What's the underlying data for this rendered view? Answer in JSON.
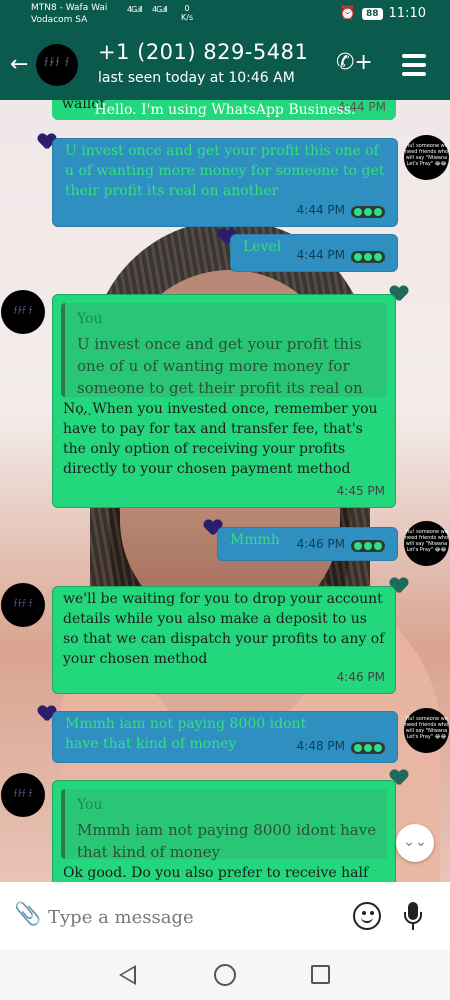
{
  "status_bar": {
    "carrier_line1": "MTN8 - Wafa Wai",
    "carrier_line2": "Vodacom SA",
    "network_a": "4G",
    "network_b": "4G",
    "speed_value": "0",
    "speed_unit": "K/s",
    "battery": "88",
    "time": "11:10"
  },
  "header": {
    "contact_name": "+1 (201) 829-5481",
    "last_seen": "last seen today at 10:46 AM",
    "avatar_text": "⨍⨑⨍ ⨍"
  },
  "chat": {
    "business_status": "Hello. I'm using WhatsApp Business.",
    "wallet_snippet": "wallet",
    "wallet_time": "4:44 PM",
    "friend_pic_text": "Yiu! someone we need friends who will say \"Ntwana Let's Pray\" 😂😂",
    "messages": [
      {
        "type": "out",
        "text": "U invest once and get your profit this one of u of wanting more money for someone to get their profit its real on another",
        "time": "4:44 PM"
      },
      {
        "type": "out",
        "text": "Level",
        "time": "4:44 PM"
      },
      {
        "type": "in",
        "quote_author": "You",
        "quote_text": "U invest once and get your profit this one of u of wanting more money for someone to get their profit its real on …",
        "text": "No. When you invested once, remember you have to pay for tax and transfer fee, that's the only option of receiving your profits directly to your chosen payment method",
        "time": "4:45 PM"
      },
      {
        "type": "out",
        "text": "Mmmh",
        "time": "4:46 PM"
      },
      {
        "type": "in",
        "text": "we'll be waiting for you to drop your account details while you also make a deposit to us so that we can dispatch your profits to any of your chosen method",
        "time": "4:46 PM"
      },
      {
        "type": "out",
        "text": "Mmmh iam not paying 8000 idont have that kind of money",
        "time": "4:48 PM"
      },
      {
        "type": "in",
        "quote_author": "You",
        "quote_text": "Mmmh iam not paying 8000 idont have that kind of money",
        "text": "Ok good. Do you also prefer to receive half of"
      }
    ]
  },
  "input": {
    "placeholder": "Type a message"
  },
  "icons": {
    "back": "arrow-left",
    "call_add": "phone-plus",
    "menu": "hamburger",
    "attach": "paperclip",
    "emoji": "smiley",
    "mic": "microphone",
    "scroll": "double-chevron-down"
  }
}
